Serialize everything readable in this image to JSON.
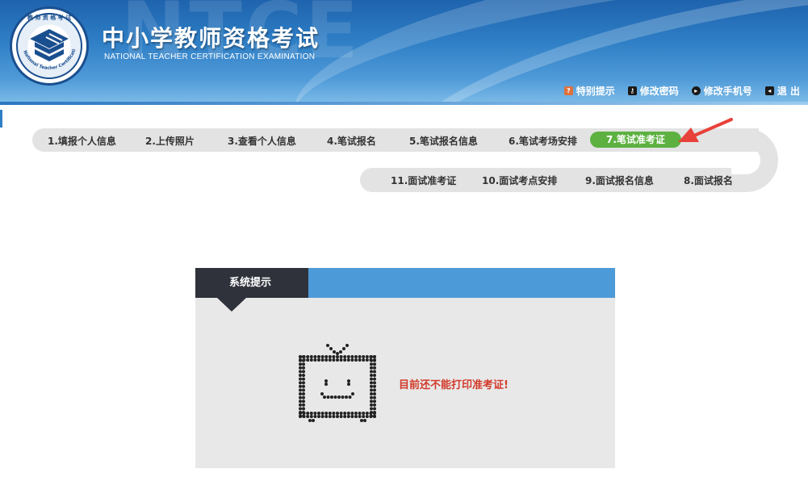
{
  "header": {
    "watermark": "NTCE",
    "title_cn": "中小学教师资格考试",
    "title_en": "NATIONAL TEACHER CERTIFICATION EXAMINATION",
    "logo": {
      "top_text": "教 师 资 格 考 试",
      "ring_text": "National Teacher Certification Examination"
    },
    "links": [
      {
        "label": "特别提示",
        "icon": "help-icon"
      },
      {
        "label": "修改密码",
        "icon": "key-icon"
      },
      {
        "label": "修改手机号",
        "icon": "phone-icon"
      },
      {
        "label": "退 出",
        "icon": "exit-icon"
      }
    ]
  },
  "steps": {
    "row1": [
      "1.填报个人信息",
      "2.上传照片",
      "3.查看个人信息",
      "4.笔试报名",
      "5.笔试报名信息",
      "6.笔试考场安排",
      "7.笔试准考证"
    ],
    "row2": [
      "11.面试准考证",
      "10.面试考点安排",
      "9.面试报名信息",
      "8.面试报名"
    ],
    "active": "7.笔试准考证",
    "active_color": "#5cb141"
  },
  "notice": {
    "tab_label": "系统提示",
    "message": "目前还不能打印准考证!",
    "message_color": "#d23a2a",
    "icon": "tv-face-icon"
  },
  "colors": {
    "header_blue": "#2f7fc6",
    "notice_bar": "#4d9ad8",
    "notice_tab": "#2f323b",
    "arrow_red": "#e8413a"
  }
}
